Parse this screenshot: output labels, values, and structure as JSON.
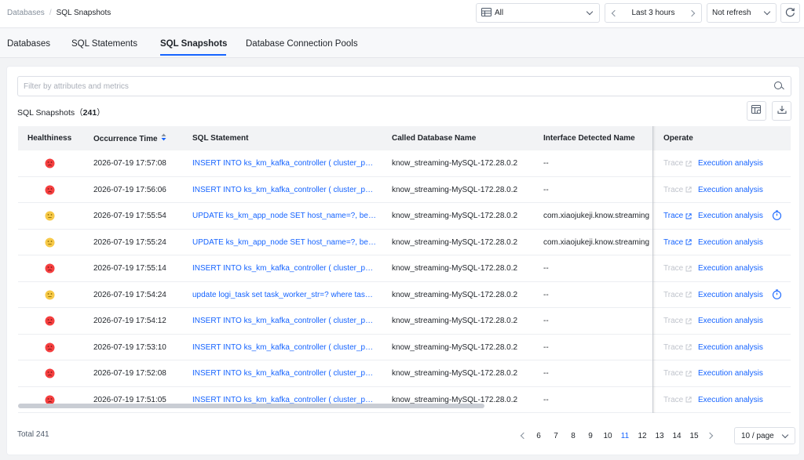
{
  "breadcrumb": {
    "parent": "Databases",
    "separator": "/",
    "current": "SQL Snapshots"
  },
  "toolbar": {
    "environment": "All",
    "time_range": "Last 3 hours",
    "refresh": "Not refresh"
  },
  "tabs": [
    {
      "label": "Databases"
    },
    {
      "label": "SQL Statements"
    },
    {
      "label": "SQL Snapshots"
    },
    {
      "label": "Database Connection Pools"
    }
  ],
  "filter": {
    "placeholder": "Filter by attributes and metrics"
  },
  "list": {
    "title": "SQL Snapshots",
    "count_open": "（",
    "count": "241",
    "count_close": "）"
  },
  "table": {
    "columns": {
      "health": "Healthiness",
      "time": "Occurrence Time",
      "sql": "SQL Statement",
      "db": "Called Database Name",
      "iface": "Interface Detected Name",
      "operate": "Operate"
    },
    "trace_label": "Trace",
    "exec_label": "Execution analysis",
    "rows": [
      {
        "health": "bad",
        "time": "2026-07-19 17:57:08",
        "sql": "INSERT INTO ks_km_kafka_controller ( cluster_phy_id, broker_id, ...",
        "db": "know_streaming-MySQL-172.28.0.2",
        "iface": "--",
        "trace_enabled": false,
        "slow": false
      },
      {
        "health": "bad",
        "time": "2026-07-19 17:56:06",
        "sql": "INSERT INTO ks_km_kafka_controller ( cluster_phy_id, broker_id, ...",
        "db": "know_streaming-MySQL-172.28.0.2",
        "iface": "--",
        "trace_enabled": false,
        "slow": false
      },
      {
        "health": "warn",
        "time": "2026-07-19 17:55:54",
        "sql": "UPDATE ks_km_app_node SET host_name=?, beat_time=? ...",
        "db": "know_streaming-MySQL-172.28.0.2",
        "iface": "com.xiaojukeji.know.streaming",
        "trace_enabled": true,
        "slow": true
      },
      {
        "health": "warn",
        "time": "2026-07-19 17:55:24",
        "sql": "UPDATE ks_km_app_node SET host_name=?, beat_time=? ...",
        "db": "know_streaming-MySQL-172.28.0.2",
        "iface": "com.xiaojukeji.know.streaming",
        "trace_enabled": true,
        "slow": false
      },
      {
        "health": "bad",
        "time": "2026-07-19 17:55:14",
        "sql": "INSERT INTO ks_km_kafka_controller ( cluster_phy_id, broker_id, ...",
        "db": "know_streaming-MySQL-172.28.0.2",
        "iface": "--",
        "trace_enabled": false,
        "slow": false
      },
      {
        "health": "warn",
        "time": "2026-07-19 17:54:24",
        "sql": "update logi_task set task_worker_str=? where task_code=? ...",
        "db": "know_streaming-MySQL-172.28.0.2",
        "iface": "--",
        "trace_enabled": false,
        "slow": true
      },
      {
        "health": "bad",
        "time": "2026-07-19 17:54:12",
        "sql": "INSERT INTO ks_km_kafka_controller ( cluster_phy_id, broker_id, ...",
        "db": "know_streaming-MySQL-172.28.0.2",
        "iface": "--",
        "trace_enabled": false,
        "slow": false
      },
      {
        "health": "bad",
        "time": "2026-07-19 17:53:10",
        "sql": "INSERT INTO ks_km_kafka_controller ( cluster_phy_id, broker_id, ...",
        "db": "know_streaming-MySQL-172.28.0.2",
        "iface": "--",
        "trace_enabled": false,
        "slow": false
      },
      {
        "health": "bad",
        "time": "2026-07-19 17:52:08",
        "sql": "INSERT INTO ks_km_kafka_controller ( cluster_phy_id, broker_id, ...",
        "db": "know_streaming-MySQL-172.28.0.2",
        "iface": "--",
        "trace_enabled": false,
        "slow": false
      },
      {
        "health": "bad",
        "time": "2026-07-19 17:51:05",
        "sql": "INSERT INTO ks_km_kafka_controller ( cluster_phy_id, broker_id, ...",
        "db": "know_streaming-MySQL-172.28.0.2",
        "iface": "--",
        "trace_enabled": false,
        "slow": false
      }
    ]
  },
  "footer": {
    "total": "Total 241",
    "pages": [
      "6",
      "7",
      "8",
      "9",
      "10",
      "11",
      "12",
      "13",
      "14",
      "15"
    ],
    "current_page": "11",
    "page_size": "10 / page"
  },
  "colors": {
    "accent": "#1664ff",
    "bad": "#f53f3f",
    "warn": "#f7c948"
  },
  "icons": {
    "env": "database-icon",
    "reload": "refresh-icon",
    "search": "search-icon",
    "columns": "column-settings-icon",
    "download": "download-icon",
    "bad": "frown-face-icon",
    "warn": "neutral-face-icon",
    "external": "external-link-icon",
    "slow": "stopwatch-icon"
  }
}
